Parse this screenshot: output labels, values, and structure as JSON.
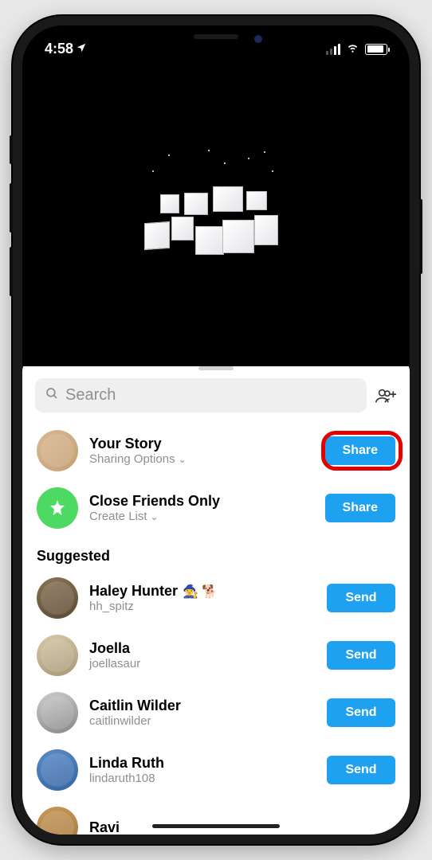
{
  "status": {
    "time": "4:58",
    "location_icon": "location-arrow-icon"
  },
  "search": {
    "placeholder": "Search"
  },
  "story_rows": [
    {
      "title": "Your Story",
      "subtitle": "Sharing Options",
      "action": "Share",
      "avatar": "av-story",
      "highlighted": true
    },
    {
      "title": "Close Friends Only",
      "subtitle": "Create List",
      "action": "Share",
      "avatar": "av-close",
      "star": true
    }
  ],
  "section_label": "Suggested",
  "suggested": [
    {
      "name": "Haley Hunter",
      "username": "hh_spitz",
      "action": "Send",
      "emoji": "🧙‍♀️ 🐕",
      "avatar": "av1"
    },
    {
      "name": "Joella",
      "username": "joellasaur",
      "action": "Send",
      "avatar": "av2"
    },
    {
      "name": "Caitlin Wilder",
      "username": "caitlinwilder",
      "action": "Send",
      "avatar": "av3"
    },
    {
      "name": "Linda Ruth",
      "username": "lindaruth108",
      "action": "Send",
      "avatar": "av4"
    },
    {
      "name": "Ravi",
      "username": "",
      "action": "",
      "avatar": "av5",
      "partial": true
    }
  ]
}
